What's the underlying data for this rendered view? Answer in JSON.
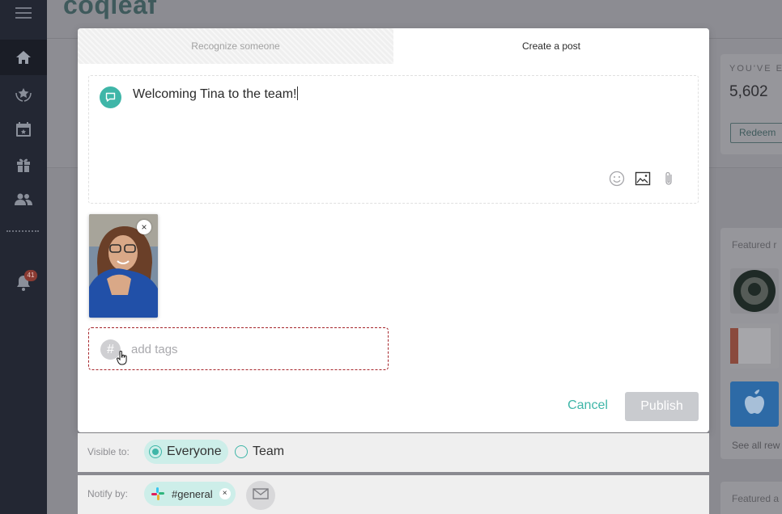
{
  "app": {
    "logo_text": "coqleaf",
    "notification_count": "41"
  },
  "sidebar": {
    "items": [
      {
        "name": "menu-icon"
      },
      {
        "name": "home-icon",
        "active": true
      },
      {
        "name": "award-icon"
      },
      {
        "name": "calendar-icon"
      },
      {
        "name": "gift-icon"
      },
      {
        "name": "people-icon"
      },
      {
        "name": "bell-icon"
      }
    ]
  },
  "background": {
    "points_label": "YOU'VE E",
    "points_value": "5,602",
    "redeem_label": "Redeem",
    "featured_label": "Featured r",
    "see_all_label": "See all rew",
    "featured2_label": "Featured a"
  },
  "modal": {
    "tabs": [
      {
        "label": "Recognize someone",
        "active": false
      },
      {
        "label": "Create a post",
        "active": true
      }
    ],
    "composer": {
      "text": "Welcoming Tina to the team!",
      "tools": [
        "emoji-icon",
        "image-icon",
        "paperclip-icon"
      ]
    },
    "attachment": {
      "remove_label": "×"
    },
    "tags": {
      "placeholder": "add tags",
      "value": ""
    },
    "actions": {
      "cancel_label": "Cancel",
      "publish_label": "Publish"
    }
  },
  "visibility": {
    "label": "Visible to:",
    "options": [
      {
        "label": "Everyone",
        "selected": true
      },
      {
        "label": "Team",
        "selected": false
      }
    ]
  },
  "notify": {
    "label": "Notify by:",
    "channel": "#general",
    "remove_label": "×"
  },
  "colors": {
    "accent": "#3fb6a8",
    "sidebar": "#232733",
    "tag_border": "#a7272c",
    "publish_disabled": "#c9cbcf"
  }
}
